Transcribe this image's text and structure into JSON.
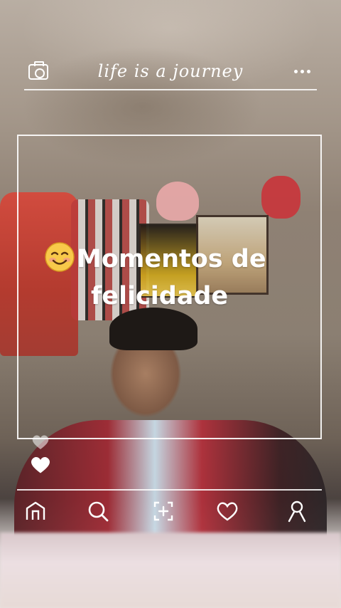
{
  "header": {
    "title": "life is a journey",
    "camera_icon": "camera-icon",
    "more_icon": "more-dots-icon"
  },
  "caption": {
    "emoji": "😊",
    "line1": "Momentos de",
    "line2": "felicidade"
  },
  "reactions": {
    "icons": [
      "heart-icon-faded",
      "heart-icon"
    ]
  },
  "bottom_nav": {
    "items": [
      {
        "icon": "home-icon"
      },
      {
        "icon": "search-icon"
      },
      {
        "icon": "add-post-icon"
      },
      {
        "icon": "heart-icon"
      },
      {
        "icon": "profile-icon"
      }
    ]
  },
  "colors": {
    "overlay": "#ffffff",
    "emoji_face": "#f8c94a"
  }
}
